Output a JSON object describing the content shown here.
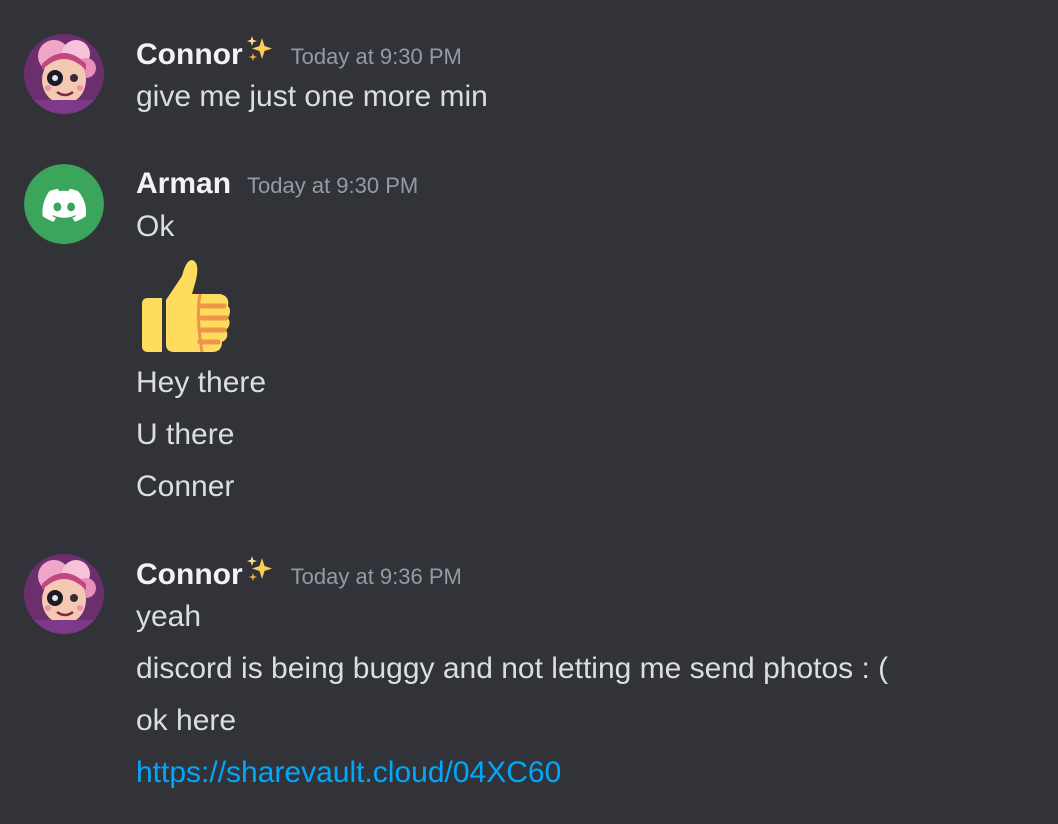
{
  "messages": [
    {
      "author": "Connor",
      "timestamp": "Today at 9:30 PM",
      "lines": [
        "give me just one more min"
      ]
    },
    {
      "author": "Arman",
      "timestamp": "Today at 9:30 PM",
      "lines": [
        "Ok",
        "Hey there",
        "U there",
        "Conner"
      ],
      "emoji": "thumbs-up"
    },
    {
      "author": "Connor",
      "timestamp": "Today at 9:36 PM",
      "lines": [
        "yeah",
        "discord is being buggy and not letting me send photos : (",
        "ok here"
      ],
      "link": "https://sharevault.cloud/04XC60"
    }
  ],
  "icons": {
    "author_badge": "sparkles-icon",
    "default_avatar": "discord-logo-icon",
    "reaction_emoji": "thumbs-up-emoji"
  },
  "colors": {
    "background": "#313338",
    "username": "#f2f3f5",
    "timestamp": "#949ba4",
    "message_text": "#dbdee1",
    "link": "#00a8fc",
    "default_avatar_bg": "#3ba55c"
  }
}
